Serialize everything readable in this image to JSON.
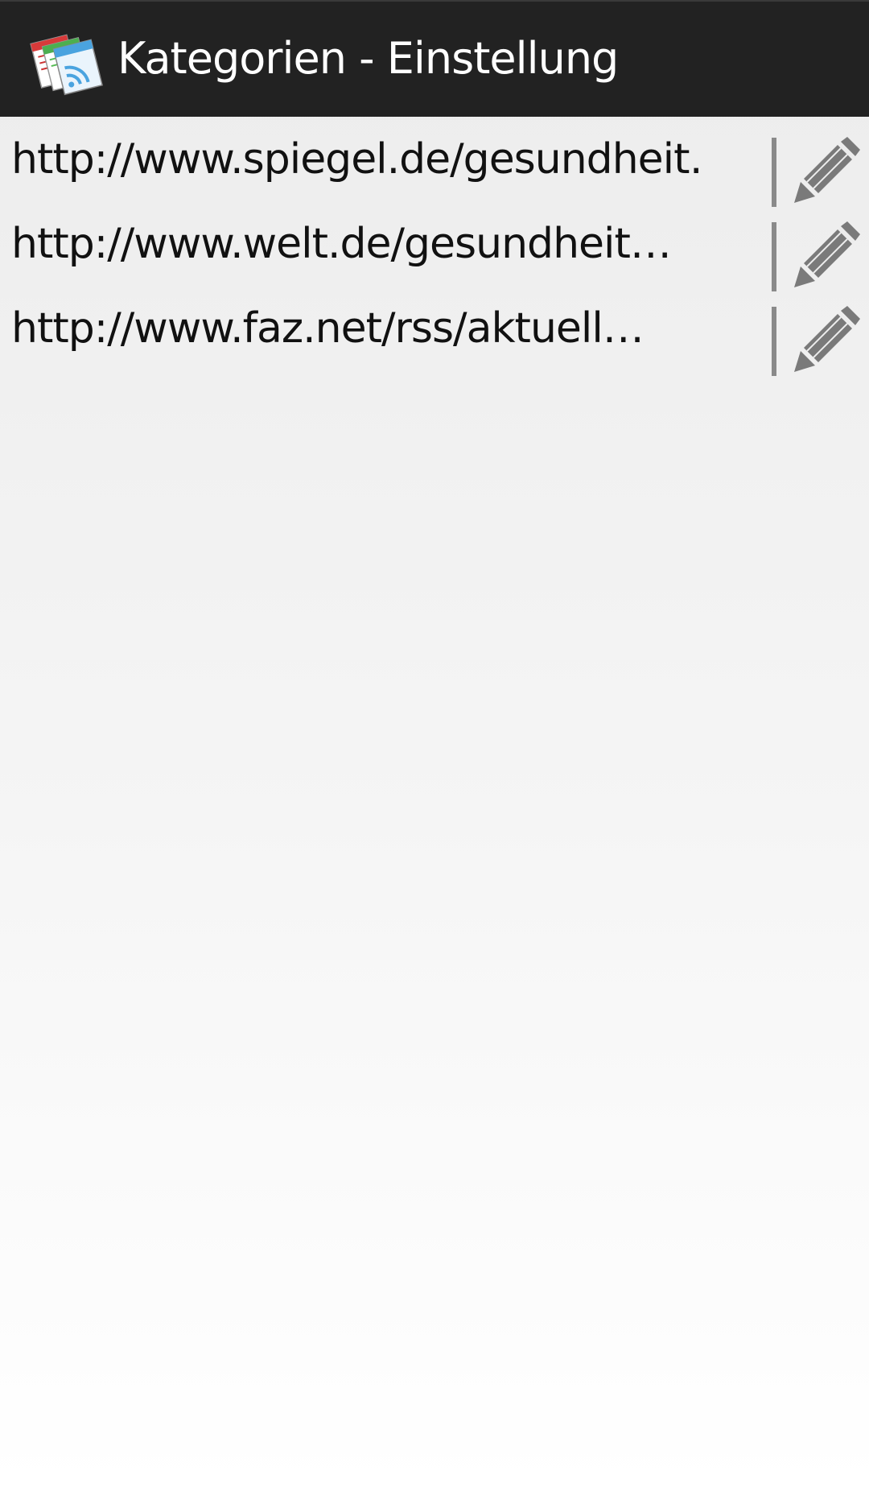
{
  "action_bar": {
    "title": "Kategorien - Einstellung",
    "icon": "rss-feeds-app-icon"
  },
  "feeds": [
    {
      "url": "http://www.spiegel.de/gesundheit…",
      "edit_icon": "pencil-icon"
    },
    {
      "url": "http://www.welt.de/gesundheit…",
      "edit_icon": "pencil-icon"
    },
    {
      "url": "http://www.faz.net/rss/aktuell…",
      "edit_icon": "pencil-icon"
    }
  ],
  "colors": {
    "action_bar_bg": "#222222",
    "title_text": "#ffffff",
    "list_text": "#111111",
    "icon_gray": "#7a7a7a"
  }
}
